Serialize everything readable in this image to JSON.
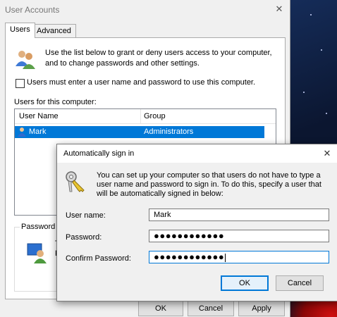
{
  "user_accounts": {
    "title": "User Accounts",
    "close_glyph": "✕",
    "tabs": [
      {
        "label": "Users"
      },
      {
        "label": "Advanced"
      }
    ],
    "intro": "Use the list below to grant or deny users access to your computer, and to change passwords and other settings.",
    "checkbox_label": "Users must enter a user name and password to use this computer.",
    "users_label": "Users for this computer:",
    "columns": [
      "User Name",
      "Group"
    ],
    "rows": [
      {
        "name": "Mark",
        "group": "Administrators"
      }
    ],
    "password_group_label": "Password fo",
    "password_text_1": "T",
    "password_text_2": "P",
    "buttons": {
      "ok": "OK",
      "cancel": "Cancel",
      "apply": "Apply"
    },
    "icons": [
      "users-group-icon",
      "user-row-icon",
      "user-password-icon",
      "close-icon"
    ]
  },
  "auto_signin": {
    "title": "Automatically sign in",
    "close_glyph": "✕",
    "description": "You can set up your computer so that users do not have to type a user name and password to sign in. To do this, specify a user that will be automatically signed in below:",
    "fields": {
      "username_label": "User name:",
      "username_value": "Mark",
      "password_label": "Password:",
      "password_value": "●●●●●●●●●●●●",
      "confirm_label": "Confirm Password:",
      "confirm_value": "●●●●●●●●●●●●"
    },
    "buttons": {
      "ok": "OK",
      "cancel": "Cancel"
    },
    "icons": [
      "keys-icon",
      "close-icon"
    ]
  },
  "colors": {
    "selection": "#0078d7",
    "dialog_bg": "#f0f0f0",
    "accent_border": "#0078d7"
  }
}
